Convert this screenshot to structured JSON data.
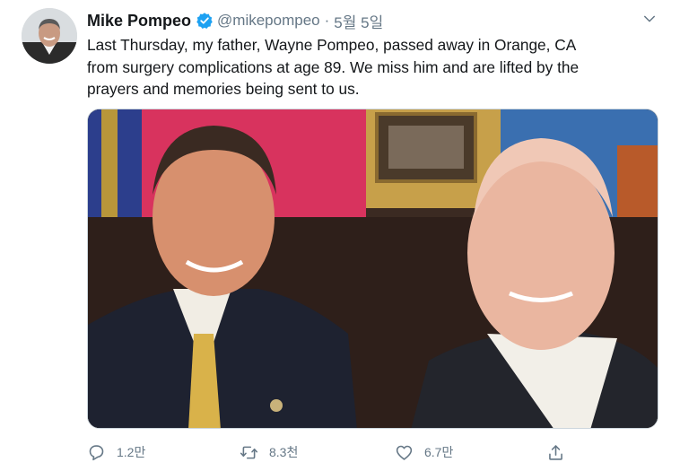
{
  "author": {
    "name": "Mike Pompeo",
    "handle": "@mikepompeo",
    "date": "5월 5일",
    "separator": "·"
  },
  "tweet": {
    "lines": [
      "Last Thursday, my father, Wayne Pompeo, passed away in Orange, CA",
      "from surgery complications at age 89. We miss him and are lifted by the",
      "prayers and memories being sent to us."
    ]
  },
  "actions": {
    "reply_count": "1.2만",
    "retweet_count": "8.3천",
    "like_count": "6.7만"
  },
  "icons": {
    "verified": "verified-badge-icon",
    "menu": "chevron-down-icon",
    "reply": "reply-icon",
    "retweet": "retweet-icon",
    "like": "heart-icon",
    "share": "share-icon"
  },
  "colors": {
    "verified": "#1da1f2",
    "muted": "#657786",
    "text": "#14171a",
    "border": "#ccd6dd"
  }
}
